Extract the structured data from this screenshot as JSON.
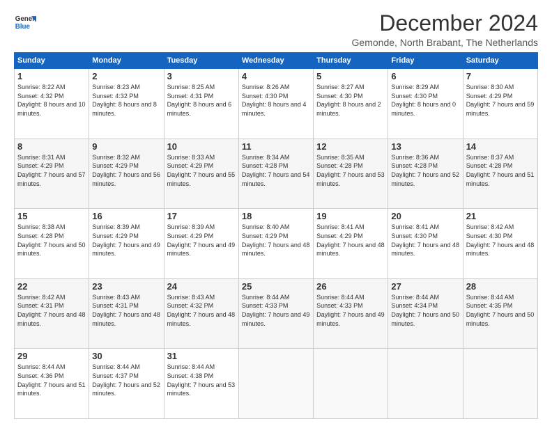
{
  "header": {
    "logo_line1": "General",
    "logo_line2": "Blue",
    "month": "December 2024",
    "location": "Gemonde, North Brabant, The Netherlands"
  },
  "weekdays": [
    "Sunday",
    "Monday",
    "Tuesday",
    "Wednesday",
    "Thursday",
    "Friday",
    "Saturday"
  ],
  "weeks": [
    [
      {
        "day": "1",
        "sunrise": "8:22 AM",
        "sunset": "4:32 PM",
        "daylight": "8 hours and 10 minutes."
      },
      {
        "day": "2",
        "sunrise": "8:23 AM",
        "sunset": "4:32 PM",
        "daylight": "8 hours and 8 minutes."
      },
      {
        "day": "3",
        "sunrise": "8:25 AM",
        "sunset": "4:31 PM",
        "daylight": "8 hours and 6 minutes."
      },
      {
        "day": "4",
        "sunrise": "8:26 AM",
        "sunset": "4:30 PM",
        "daylight": "8 hours and 4 minutes."
      },
      {
        "day": "5",
        "sunrise": "8:27 AM",
        "sunset": "4:30 PM",
        "daylight": "8 hours and 2 minutes."
      },
      {
        "day": "6",
        "sunrise": "8:29 AM",
        "sunset": "4:30 PM",
        "daylight": "8 hours and 0 minutes."
      },
      {
        "day": "7",
        "sunrise": "8:30 AM",
        "sunset": "4:29 PM",
        "daylight": "7 hours and 59 minutes."
      }
    ],
    [
      {
        "day": "8",
        "sunrise": "8:31 AM",
        "sunset": "4:29 PM",
        "daylight": "7 hours and 57 minutes."
      },
      {
        "day": "9",
        "sunrise": "8:32 AM",
        "sunset": "4:29 PM",
        "daylight": "7 hours and 56 minutes."
      },
      {
        "day": "10",
        "sunrise": "8:33 AM",
        "sunset": "4:29 PM",
        "daylight": "7 hours and 55 minutes."
      },
      {
        "day": "11",
        "sunrise": "8:34 AM",
        "sunset": "4:28 PM",
        "daylight": "7 hours and 54 minutes."
      },
      {
        "day": "12",
        "sunrise": "8:35 AM",
        "sunset": "4:28 PM",
        "daylight": "7 hours and 53 minutes."
      },
      {
        "day": "13",
        "sunrise": "8:36 AM",
        "sunset": "4:28 PM",
        "daylight": "7 hours and 52 minutes."
      },
      {
        "day": "14",
        "sunrise": "8:37 AM",
        "sunset": "4:28 PM",
        "daylight": "7 hours and 51 minutes."
      }
    ],
    [
      {
        "day": "15",
        "sunrise": "8:38 AM",
        "sunset": "4:28 PM",
        "daylight": "7 hours and 50 minutes."
      },
      {
        "day": "16",
        "sunrise": "8:39 AM",
        "sunset": "4:29 PM",
        "daylight": "7 hours and 49 minutes."
      },
      {
        "day": "17",
        "sunrise": "8:39 AM",
        "sunset": "4:29 PM",
        "daylight": "7 hours and 49 minutes."
      },
      {
        "day": "18",
        "sunrise": "8:40 AM",
        "sunset": "4:29 PM",
        "daylight": "7 hours and 48 minutes."
      },
      {
        "day": "19",
        "sunrise": "8:41 AM",
        "sunset": "4:29 PM",
        "daylight": "7 hours and 48 minutes."
      },
      {
        "day": "20",
        "sunrise": "8:41 AM",
        "sunset": "4:30 PM",
        "daylight": "7 hours and 48 minutes."
      },
      {
        "day": "21",
        "sunrise": "8:42 AM",
        "sunset": "4:30 PM",
        "daylight": "7 hours and 48 minutes."
      }
    ],
    [
      {
        "day": "22",
        "sunrise": "8:42 AM",
        "sunset": "4:31 PM",
        "daylight": "7 hours and 48 minutes."
      },
      {
        "day": "23",
        "sunrise": "8:43 AM",
        "sunset": "4:31 PM",
        "daylight": "7 hours and 48 minutes."
      },
      {
        "day": "24",
        "sunrise": "8:43 AM",
        "sunset": "4:32 PM",
        "daylight": "7 hours and 48 minutes."
      },
      {
        "day": "25",
        "sunrise": "8:44 AM",
        "sunset": "4:33 PM",
        "daylight": "7 hours and 49 minutes."
      },
      {
        "day": "26",
        "sunrise": "8:44 AM",
        "sunset": "4:33 PM",
        "daylight": "7 hours and 49 minutes."
      },
      {
        "day": "27",
        "sunrise": "8:44 AM",
        "sunset": "4:34 PM",
        "daylight": "7 hours and 50 minutes."
      },
      {
        "day": "28",
        "sunrise": "8:44 AM",
        "sunset": "4:35 PM",
        "daylight": "7 hours and 50 minutes."
      }
    ],
    [
      {
        "day": "29",
        "sunrise": "8:44 AM",
        "sunset": "4:36 PM",
        "daylight": "7 hours and 51 minutes."
      },
      {
        "day": "30",
        "sunrise": "8:44 AM",
        "sunset": "4:37 PM",
        "daylight": "7 hours and 52 minutes."
      },
      {
        "day": "31",
        "sunrise": "8:44 AM",
        "sunset": "4:38 PM",
        "daylight": "7 hours and 53 minutes."
      },
      null,
      null,
      null,
      null
    ]
  ]
}
